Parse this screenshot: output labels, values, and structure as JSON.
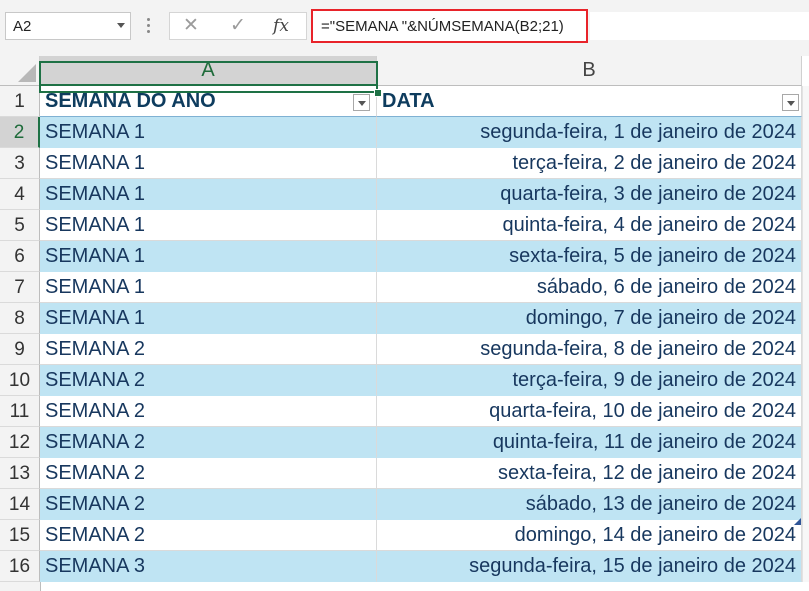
{
  "formula_bar": {
    "name_box": "A2",
    "cancel_icon": "✕",
    "enter_icon": "✓",
    "fx_label": "fx",
    "formula": "=\"SEMANA \"&NÚMSEMANA(B2;21)"
  },
  "sheet": {
    "columns": [
      "A",
      "B"
    ],
    "selected_column": "A",
    "active_cell": "A2",
    "header_row": {
      "number": "1",
      "a": "SEMANA DO ANO",
      "b": "DATA"
    },
    "rows": [
      {
        "number": "2",
        "a": "SEMANA 1",
        "b": "segunda-feira, 1 de janeiro de 2024"
      },
      {
        "number": "3",
        "a": "SEMANA 1",
        "b": "terça-feira, 2 de janeiro de 2024"
      },
      {
        "number": "4",
        "a": "SEMANA 1",
        "b": "quarta-feira, 3 de janeiro de 2024"
      },
      {
        "number": "5",
        "a": "SEMANA 1",
        "b": "quinta-feira, 4 de janeiro de 2024"
      },
      {
        "number": "6",
        "a": "SEMANA 1",
        "b": "sexta-feira, 5 de janeiro de 2024"
      },
      {
        "number": "7",
        "a": "SEMANA 1",
        "b": "sábado, 6 de janeiro de 2024"
      },
      {
        "number": "8",
        "a": "SEMANA 1",
        "b": "domingo, 7 de janeiro de 2024"
      },
      {
        "number": "9",
        "a": "SEMANA 2",
        "b": "segunda-feira, 8 de janeiro de 2024"
      },
      {
        "number": "10",
        "a": "SEMANA 2",
        "b": "terça-feira, 9 de janeiro de 2024"
      },
      {
        "number": "11",
        "a": "SEMANA 2",
        "b": "quarta-feira, 10 de janeiro de 2024"
      },
      {
        "number": "12",
        "a": "SEMANA 2",
        "b": "quinta-feira, 11 de janeiro de 2024"
      },
      {
        "number": "13",
        "a": "SEMANA 2",
        "b": "sexta-feira, 12 de janeiro de 2024"
      },
      {
        "number": "14",
        "a": "SEMANA 2",
        "b": "sábado, 13 de janeiro de 2024"
      },
      {
        "number": "15",
        "a": "SEMANA 2",
        "b": "domingo, 14 de janeiro de 2024"
      },
      {
        "number": "16",
        "a": "SEMANA 3",
        "b": "segunda-feira, 15 de janeiro de 2024"
      }
    ]
  },
  "colors": {
    "band": "#bfe4f3",
    "text": "#17375e",
    "selection": "#1e7145",
    "formula_highlight": "#e8232a"
  }
}
